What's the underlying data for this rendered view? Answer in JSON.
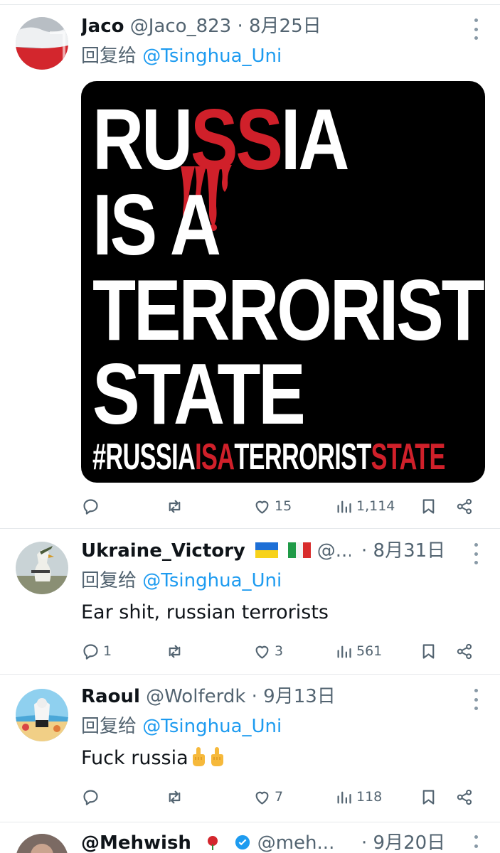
{
  "tweets": [
    {
      "name": "Jaco",
      "handle": "@Jaco_823",
      "date": "· 8月25日",
      "reply_prefix": "回复给",
      "reply_to": "@Tsinghua_Uni",
      "poster": {
        "line1_a": "RU",
        "line1_b": "SS",
        "line1_c": "IA",
        "line2": "IS A",
        "line3": "TERRORIST",
        "line4": "STATE",
        "hashtag_a": "#RUSSIA",
        "hashtag_b": "ISA",
        "hashtag_c": "TERRORIST",
        "hashtag_d": "STATE"
      },
      "stats": {
        "replies": "",
        "retweets": "",
        "likes": "15",
        "views": "1,114"
      }
    },
    {
      "name": "Ukraine_Victory",
      "handle": "@...",
      "date": "· 8月31日",
      "reply_prefix": "回复给",
      "reply_to": "@Tsinghua_Uni",
      "text": "Ear shit, russian terrorists",
      "stats": {
        "replies": "1",
        "retweets": "",
        "likes": "3",
        "views": "561"
      }
    },
    {
      "name": "Raoul",
      "handle": "@Wolferdk",
      "date": "· 9月13日",
      "reply_prefix": "回复给",
      "reply_to": "@Tsinghua_Uni",
      "text": "Fuck russia",
      "stats": {
        "replies": "",
        "retweets": "",
        "likes": "7",
        "views": "118"
      }
    },
    {
      "name": "@Mehwish",
      "handle": "@meh...",
      "date": "· 9月20日"
    }
  ],
  "icons": [
    "reply-icon",
    "retweet-icon",
    "like-icon",
    "views-icon",
    "bookmark-icon",
    "share-icon",
    "more-icon"
  ],
  "colors": {
    "accent": "#1d9bf0",
    "muted": "#536471",
    "poster_red": "#d0202a"
  }
}
